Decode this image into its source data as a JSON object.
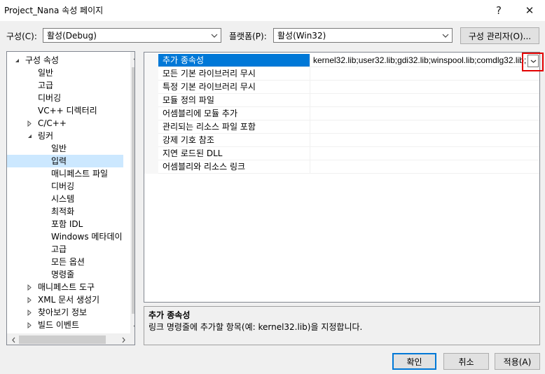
{
  "window": {
    "title": "Project_Nana 속성 페이지",
    "help_glyph": "?",
    "close_glyph": "✕"
  },
  "config": {
    "config_label": "구성(C):",
    "config_value": "활성(Debug)",
    "platform_label": "플랫폼(P):",
    "platform_value": "활성(Win32)",
    "manager_button": "구성 관리자(O)..."
  },
  "tree": {
    "items": [
      {
        "label": "구성 속성",
        "expander": "expanded"
      },
      {
        "label": "일반"
      },
      {
        "label": "고급"
      },
      {
        "label": "디버깅"
      },
      {
        "label": "VC++ 디렉터리"
      },
      {
        "label": "C/C++",
        "expander": "collapsed"
      },
      {
        "label": "링커",
        "expander": "expanded"
      },
      {
        "label": "일반"
      },
      {
        "label": "입력",
        "selected": true
      },
      {
        "label": "매니페스트 파일"
      },
      {
        "label": "디버깅"
      },
      {
        "label": "시스템"
      },
      {
        "label": "최적화"
      },
      {
        "label": "포함 IDL"
      },
      {
        "label": "Windows 메타데이"
      },
      {
        "label": "고급"
      },
      {
        "label": "모든 옵션"
      },
      {
        "label": "명령줄"
      },
      {
        "label": "매니페스트 도구",
        "expander": "collapsed"
      },
      {
        "label": "XML 문서 생성기",
        "expander": "collapsed"
      },
      {
        "label": "찾아보기 정보",
        "expander": "collapsed"
      },
      {
        "label": "빌드 이벤트",
        "expander": "collapsed"
      }
    ]
  },
  "grid": {
    "rows": [
      {
        "name": "추가 종속성",
        "value": "kernel32.lib;user32.lib;gdi32.lib;winspool.lib;comdlg32.lib;",
        "selected": true
      },
      {
        "name": "모든 기본 라이브러리 무시",
        "value": ""
      },
      {
        "name": "특정 기본 라이브러리 무시",
        "value": ""
      },
      {
        "name": "모듈 정의 파일",
        "value": ""
      },
      {
        "name": "어셈블리에 모듈 추가",
        "value": ""
      },
      {
        "name": "관리되는 리소스 파일 포함",
        "value": ""
      },
      {
        "name": "강제 기호 참조",
        "value": ""
      },
      {
        "name": "지연 로드된 DLL",
        "value": ""
      },
      {
        "name": "어셈블리와 리소스 링크",
        "value": ""
      }
    ]
  },
  "description": {
    "title": "추가 종속성",
    "text": "링크 명령줄에 추가할 항목(예: kernel32.lib)을 지정합니다."
  },
  "footer": {
    "ok": "확인",
    "cancel": "취소",
    "apply": "적용(A)"
  },
  "colors": {
    "selection": "#0078d7",
    "tree_selection": "#cce8ff",
    "highlight_box": "#e30000"
  },
  "icons": {
    "expanded": "triangle-expanded-icon",
    "collapsed": "triangle-collapsed-icon",
    "dropdown": "chevron-down-icon"
  }
}
